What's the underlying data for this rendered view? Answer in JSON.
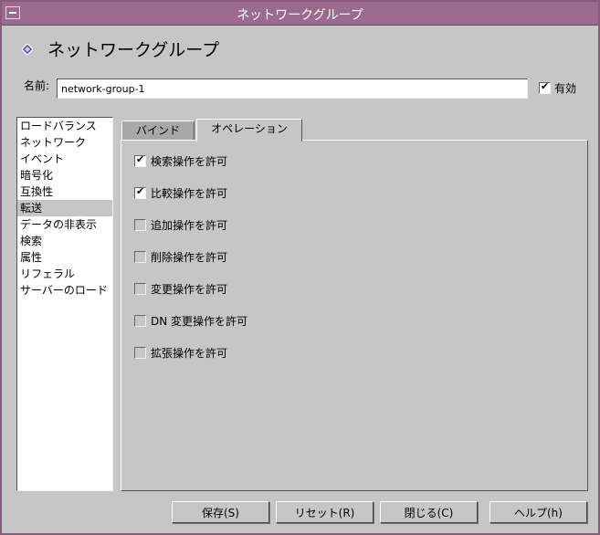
{
  "window": {
    "title": "ネットワークグループ"
  },
  "header": {
    "title": "ネットワークグループ",
    "icon": "diamond-icon"
  },
  "name_field": {
    "label": "名前:",
    "value": "network-group-1"
  },
  "enabled": {
    "label": "有効",
    "checked": true
  },
  "sidebar": {
    "items": [
      {
        "label": "ロードバランス"
      },
      {
        "label": "ネットワーク"
      },
      {
        "label": "イベント"
      },
      {
        "label": "暗号化"
      },
      {
        "label": "互換性"
      },
      {
        "label": "転送",
        "selected": true
      },
      {
        "label": "データの非表示"
      },
      {
        "label": "検索"
      },
      {
        "label": "属性"
      },
      {
        "label": "リフェラル"
      },
      {
        "label": "サーバーのロード"
      }
    ]
  },
  "tabs": [
    {
      "label": "バインド",
      "active": false
    },
    {
      "label": "オペレーション",
      "active": true
    }
  ],
  "operations": [
    {
      "label": "検索操作を許可",
      "checked": true
    },
    {
      "label": "比較操作を許可",
      "checked": true
    },
    {
      "label": "追加操作を許可",
      "checked": false
    },
    {
      "label": "削除操作を許可",
      "checked": false
    },
    {
      "label": "変更操作を許可",
      "checked": false
    },
    {
      "label": "DN 変更操作を許可",
      "checked": false
    },
    {
      "label": "拡張操作を許可",
      "checked": false
    }
  ],
  "buttons": {
    "save": "保存(S)",
    "reset": "リセット(R)",
    "close": "閉じる(C)",
    "help": "ヘルプ(h)"
  },
  "colors": {
    "titlebar": "#9a6b8e",
    "background": "#c6c6c6",
    "icon": "#5a5aa0"
  }
}
